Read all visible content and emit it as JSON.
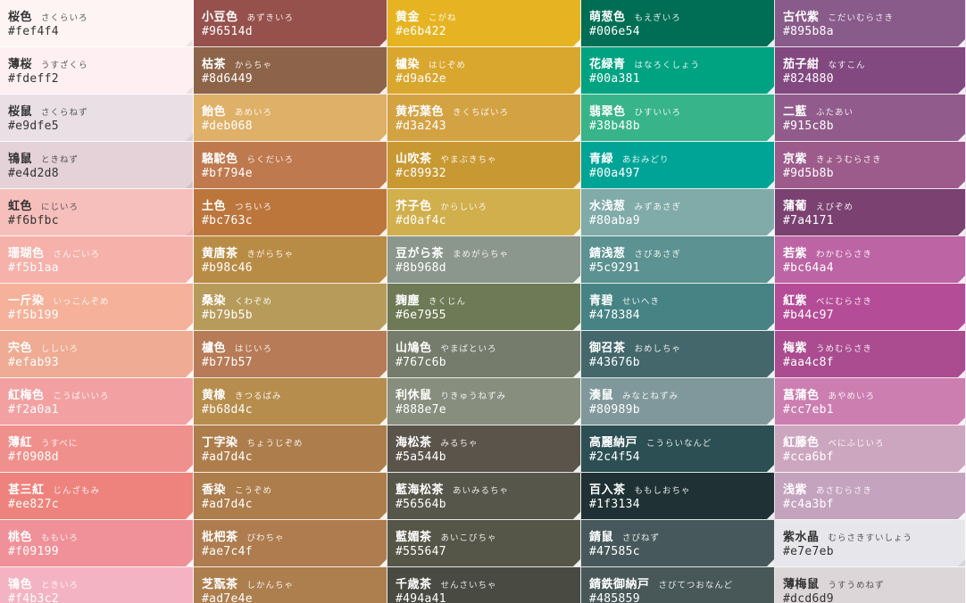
{
  "columns": [
    [
      {
        "name": "桜色",
        "kana": "さくらいろ",
        "hex": "#fef4f4"
      },
      {
        "name": "薄桜",
        "kana": "うすざくら",
        "hex": "#fdeff2"
      },
      {
        "name": "桜鼠",
        "kana": "さくらねず",
        "hex": "#e9dfe5"
      },
      {
        "name": "鴇鼠",
        "kana": "ときねず",
        "hex": "#e4d2d8"
      },
      {
        "name": "虹色",
        "kana": "にじいろ",
        "hex": "#f6bfbc"
      },
      {
        "name": "珊瑚色",
        "kana": "さんごいろ",
        "hex": "#f5b1aa"
      },
      {
        "name": "一斤染",
        "kana": "いっこんぞめ",
        "hex": "#f5b199"
      },
      {
        "name": "宍色",
        "kana": "ししいろ",
        "hex": "#efab93"
      },
      {
        "name": "紅梅色",
        "kana": "こうばいいろ",
        "hex": "#f2a0a1"
      },
      {
        "name": "薄紅",
        "kana": "うすべに",
        "hex": "#f0908d"
      },
      {
        "name": "甚三紅",
        "kana": "じんざもみ",
        "hex": "#ee827c"
      },
      {
        "name": "桃色",
        "kana": "ももいろ",
        "hex": "#f09199"
      },
      {
        "name": "鴇色",
        "kana": "ときいろ",
        "hex": "#f4b3c2"
      }
    ],
    [
      {
        "name": "小豆色",
        "kana": "あずきいろ",
        "hex": "#96514d"
      },
      {
        "name": "枯茶",
        "kana": "からちゃ",
        "hex": "#8d6449"
      },
      {
        "name": "飴色",
        "kana": "あめいろ",
        "hex": "#deb068"
      },
      {
        "name": "駱駝色",
        "kana": "らくだいろ",
        "hex": "#bf794e"
      },
      {
        "name": "土色",
        "kana": "つちいろ",
        "hex": "#bc763c"
      },
      {
        "name": "黄唐茶",
        "kana": "きがらちゃ",
        "hex": "#b98c46"
      },
      {
        "name": "桑染",
        "kana": "くわぞめ",
        "hex": "#b79b5b"
      },
      {
        "name": "櫨色",
        "kana": "はじいろ",
        "hex": "#b77b57"
      },
      {
        "name": "黄橡",
        "kana": "きつるばみ",
        "hex": "#b68d4c"
      },
      {
        "name": "丁字染",
        "kana": "ちょうじぞめ",
        "hex": "#ad7d4c"
      },
      {
        "name": "香染",
        "kana": "こうぞめ",
        "hex": "#ad7d4c"
      },
      {
        "name": "枇杷茶",
        "kana": "びわちゃ",
        "hex": "#ae7c4f"
      },
      {
        "name": "芝翫茶",
        "kana": "しかんちゃ",
        "hex": "#ad7e4e"
      }
    ],
    [
      {
        "name": "黄金",
        "kana": "こがね",
        "hex": "#e6b422"
      },
      {
        "name": "櫨染",
        "kana": "はじぞめ",
        "hex": "#d9a62e"
      },
      {
        "name": "黄朽葉色",
        "kana": "きくちばいろ",
        "hex": "#d3a243"
      },
      {
        "name": "山吹茶",
        "kana": "やまぶきちゃ",
        "hex": "#c89932"
      },
      {
        "name": "芥子色",
        "kana": "からしいろ",
        "hex": "#d0af4c"
      },
      {
        "name": "豆がら茶",
        "kana": "まめがらちゃ",
        "hex": "#8b968d"
      },
      {
        "name": "麹塵",
        "kana": "きくじん",
        "hex": "#6e7955"
      },
      {
        "name": "山鳩色",
        "kana": "やまばといろ",
        "hex": "#767c6b"
      },
      {
        "name": "利休鼠",
        "kana": "りきゅうねずみ",
        "hex": "#888e7e"
      },
      {
        "name": "海松茶",
        "kana": "みるちゃ",
        "hex": "#5a544b"
      },
      {
        "name": "藍海松茶",
        "kana": "あいみるちゃ",
        "hex": "#56564b"
      },
      {
        "name": "藍媚茶",
        "kana": "あいこびちゃ",
        "hex": "#555647"
      },
      {
        "name": "千歳茶",
        "kana": "せんさいちゃ",
        "hex": "#494a41"
      }
    ],
    [
      {
        "name": "萌葱色",
        "kana": "もえぎいろ",
        "hex": "#006e54"
      },
      {
        "name": "花緑青",
        "kana": "はなろくしょう",
        "hex": "#00a381"
      },
      {
        "name": "翡翠色",
        "kana": "ひすいいろ",
        "hex": "#38b48b"
      },
      {
        "name": "青緑",
        "kana": "あおみどり",
        "hex": "#00a497"
      },
      {
        "name": "水浅葱",
        "kana": "みずあさぎ",
        "hex": "#80aba9"
      },
      {
        "name": "錆浅葱",
        "kana": "さびあさぎ",
        "hex": "#5c9291"
      },
      {
        "name": "青碧",
        "kana": "せいへき",
        "hex": "#478384"
      },
      {
        "name": "御召茶",
        "kana": "おめしちゃ",
        "hex": "#43676b"
      },
      {
        "name": "湊鼠",
        "kana": "みなとねずみ",
        "hex": "#80989b"
      },
      {
        "name": "高麗納戸",
        "kana": "こうらいなんど",
        "hex": "#2c4f54"
      },
      {
        "name": "百入茶",
        "kana": "ももしおちゃ",
        "hex": "#1f3134"
      },
      {
        "name": "錆鼠",
        "kana": "さびねず",
        "hex": "#47585c"
      },
      {
        "name": "錆鉄御納戸",
        "kana": "さびてつおなんど",
        "hex": "#485859"
      }
    ],
    [
      {
        "name": "古代紫",
        "kana": "こだいむらさき",
        "hex": "#895b8a"
      },
      {
        "name": "茄子紺",
        "kana": "なすこん",
        "hex": "#824880"
      },
      {
        "name": "二藍",
        "kana": "ふたあい",
        "hex": "#915c8b"
      },
      {
        "name": "京紫",
        "kana": "きょうむらさき",
        "hex": "#9d5b8b"
      },
      {
        "name": "蒲葡",
        "kana": "えびぞめ",
        "hex": "#7a4171"
      },
      {
        "name": "若紫",
        "kana": "わかむらさき",
        "hex": "#bc64a4"
      },
      {
        "name": "紅紫",
        "kana": "べにむらさき",
        "hex": "#b44c97"
      },
      {
        "name": "梅紫",
        "kana": "うめむらさき",
        "hex": "#aa4c8f"
      },
      {
        "name": "菖蒲色",
        "kana": "あやめいろ",
        "hex": "#cc7eb1"
      },
      {
        "name": "紅藤色",
        "kana": "べにふじいろ",
        "hex": "#cca6bf"
      },
      {
        "name": "浅紫",
        "kana": "あさむらさき",
        "hex": "#c4a3bf"
      },
      {
        "name": "紫水晶",
        "kana": "むらさきすいしょう",
        "hex": "#e7e7eb"
      },
      {
        "name": "薄梅鼠",
        "kana": "うすうめねず",
        "hex": "#dcd6d9"
      }
    ]
  ]
}
